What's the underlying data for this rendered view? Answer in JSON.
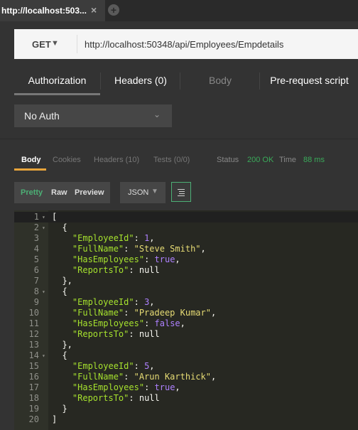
{
  "tab": {
    "title": "http://localhost:503...",
    "close": "×",
    "new": "+"
  },
  "request": {
    "method": "GET",
    "url": "http://localhost:50348/api/Employees/Empdetails",
    "tabs": [
      "Authorization",
      "Headers (0)",
      "Body",
      "Pre-request script"
    ]
  },
  "auth": {
    "selected": "No Auth"
  },
  "response": {
    "tabs": [
      "Body",
      "Cookies",
      "Headers (10)",
      "Tests (0/0)"
    ],
    "status_label": "Status",
    "status_value": "200 OK",
    "time_label": "Time",
    "time_value": "88 ms"
  },
  "view": {
    "modes": [
      "Pretty",
      "Raw",
      "Preview"
    ],
    "format": "JSON"
  },
  "code_lines": [
    [
      {
        "t": "[",
        "c": "p"
      }
    ],
    [
      {
        "t": "  {",
        "c": "p"
      }
    ],
    [
      {
        "t": "    ",
        "c": "p"
      },
      {
        "t": "\"EmployeeId\"",
        "c": "k"
      },
      {
        "t": ": ",
        "c": "p"
      },
      {
        "t": "1",
        "c": "n"
      },
      {
        "t": ",",
        "c": "p"
      }
    ],
    [
      {
        "t": "    ",
        "c": "p"
      },
      {
        "t": "\"FullName\"",
        "c": "k"
      },
      {
        "t": ": ",
        "c": "p"
      },
      {
        "t": "\"Steve Smith\"",
        "c": "s"
      },
      {
        "t": ",",
        "c": "p"
      }
    ],
    [
      {
        "t": "    ",
        "c": "p"
      },
      {
        "t": "\"HasEmployees\"",
        "c": "k"
      },
      {
        "t": ": ",
        "c": "p"
      },
      {
        "t": "true",
        "c": "n"
      },
      {
        "t": ",",
        "c": "p"
      }
    ],
    [
      {
        "t": "    ",
        "c": "p"
      },
      {
        "t": "\"ReportsTo\"",
        "c": "k"
      },
      {
        "t": ": null",
        "c": "p"
      }
    ],
    [
      {
        "t": "  },",
        "c": "p"
      }
    ],
    [
      {
        "t": "  {",
        "c": "p"
      }
    ],
    [
      {
        "t": "    ",
        "c": "p"
      },
      {
        "t": "\"EmployeeId\"",
        "c": "k"
      },
      {
        "t": ": ",
        "c": "p"
      },
      {
        "t": "3",
        "c": "n"
      },
      {
        "t": ",",
        "c": "p"
      }
    ],
    [
      {
        "t": "    ",
        "c": "p"
      },
      {
        "t": "\"FullName\"",
        "c": "k"
      },
      {
        "t": ": ",
        "c": "p"
      },
      {
        "t": "\"Pradeep Kumar\"",
        "c": "s"
      },
      {
        "t": ",",
        "c": "p"
      }
    ],
    [
      {
        "t": "    ",
        "c": "p"
      },
      {
        "t": "\"HasEmployees\"",
        "c": "k"
      },
      {
        "t": ": ",
        "c": "p"
      },
      {
        "t": "false",
        "c": "n"
      },
      {
        "t": ",",
        "c": "p"
      }
    ],
    [
      {
        "t": "    ",
        "c": "p"
      },
      {
        "t": "\"ReportsTo\"",
        "c": "k"
      },
      {
        "t": ": null",
        "c": "p"
      }
    ],
    [
      {
        "t": "  },",
        "c": "p"
      }
    ],
    [
      {
        "t": "  {",
        "c": "p"
      }
    ],
    [
      {
        "t": "    ",
        "c": "p"
      },
      {
        "t": "\"EmployeeId\"",
        "c": "k"
      },
      {
        "t": ": ",
        "c": "p"
      },
      {
        "t": "5",
        "c": "n"
      },
      {
        "t": ",",
        "c": "p"
      }
    ],
    [
      {
        "t": "    ",
        "c": "p"
      },
      {
        "t": "\"FullName\"",
        "c": "k"
      },
      {
        "t": ": ",
        "c": "p"
      },
      {
        "t": "\"Arun Karthick\"",
        "c": "s"
      },
      {
        "t": ",",
        "c": "p"
      }
    ],
    [
      {
        "t": "    ",
        "c": "p"
      },
      {
        "t": "\"HasEmployees\"",
        "c": "k"
      },
      {
        "t": ": ",
        "c": "p"
      },
      {
        "t": "true",
        "c": "n"
      },
      {
        "t": ",",
        "c": "p"
      }
    ],
    [
      {
        "t": "    ",
        "c": "p"
      },
      {
        "t": "\"ReportsTo\"",
        "c": "k"
      },
      {
        "t": ": null",
        "c": "p"
      }
    ],
    [
      {
        "t": "  }",
        "c": "p"
      }
    ],
    [
      {
        "t": "]",
        "c": "p"
      }
    ]
  ],
  "fold_lines": [
    1,
    2,
    8,
    14
  ],
  "colors": {
    "accent": "#e8a53b",
    "success": "#3aaa5a",
    "editor_bg": "#272822"
  }
}
